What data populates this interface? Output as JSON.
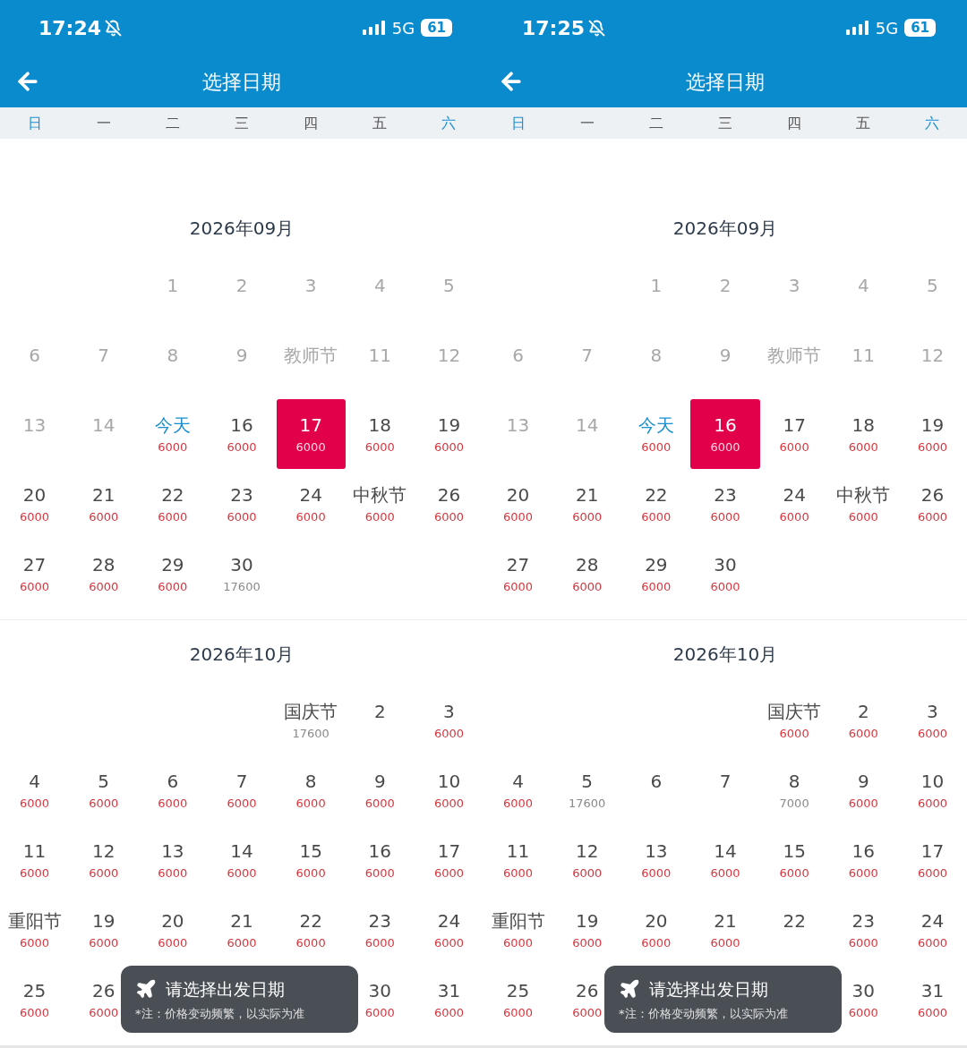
{
  "screens": [
    {
      "status_bar": {
        "time": "17:24",
        "network": "5G",
        "battery": "61"
      },
      "nav": {
        "title": "选择日期"
      },
      "weekdays": [
        {
          "label": "日",
          "weekend": true
        },
        {
          "label": "一",
          "weekend": false
        },
        {
          "label": "二",
          "weekend": false
        },
        {
          "label": "三",
          "weekend": false
        },
        {
          "label": "四",
          "weekend": false
        },
        {
          "label": "五",
          "weekend": false
        },
        {
          "label": "六",
          "weekend": true
        }
      ],
      "months": [
        {
          "title": "2026年09月",
          "days": [
            {
              "kind": "blank"
            },
            {
              "kind": "blank"
            },
            {
              "kind": "past",
              "label": "1"
            },
            {
              "kind": "past",
              "label": "2"
            },
            {
              "kind": "past",
              "label": "3"
            },
            {
              "kind": "past",
              "label": "4"
            },
            {
              "kind": "past",
              "label": "5"
            },
            {
              "kind": "past",
              "label": "6"
            },
            {
              "kind": "past",
              "label": "7"
            },
            {
              "kind": "past",
              "label": "8"
            },
            {
              "kind": "past",
              "label": "9"
            },
            {
              "kind": "past",
              "label": "教师节"
            },
            {
              "kind": "past",
              "label": "11"
            },
            {
              "kind": "past",
              "label": "12"
            },
            {
              "kind": "past",
              "label": "13"
            },
            {
              "kind": "past",
              "label": "14"
            },
            {
              "kind": "today",
              "label": "今天",
              "price": "6000",
              "price_muted": false,
              "selected": false
            },
            {
              "kind": "open",
              "label": "16",
              "price": "6000",
              "price_muted": false,
              "selected": false
            },
            {
              "kind": "open",
              "label": "17",
              "price": "6000",
              "price_muted": false,
              "selected": true
            },
            {
              "kind": "open",
              "label": "18",
              "price": "6000",
              "price_muted": false,
              "selected": false
            },
            {
              "kind": "open",
              "label": "19",
              "price": "6000",
              "price_muted": false,
              "selected": false
            },
            {
              "kind": "open",
              "label": "20",
              "price": "6000",
              "price_muted": false,
              "selected": false
            },
            {
              "kind": "open",
              "label": "21",
              "price": "6000",
              "price_muted": false,
              "selected": false
            },
            {
              "kind": "open",
              "label": "22",
              "price": "6000",
              "price_muted": false,
              "selected": false
            },
            {
              "kind": "open",
              "label": "23",
              "price": "6000",
              "price_muted": false,
              "selected": false
            },
            {
              "kind": "open",
              "label": "24",
              "price": "6000",
              "price_muted": false,
              "selected": false
            },
            {
              "kind": "open",
              "label": "中秋节",
              "price": "6000",
              "price_muted": false,
              "selected": false
            },
            {
              "kind": "open",
              "label": "26",
              "price": "6000",
              "price_muted": false,
              "selected": false
            },
            {
              "kind": "open",
              "label": "27",
              "price": "6000",
              "price_muted": false,
              "selected": false
            },
            {
              "kind": "open",
              "label": "28",
              "price": "6000",
              "price_muted": false,
              "selected": false
            },
            {
              "kind": "open",
              "label": "29",
              "price": "6000",
              "price_muted": false,
              "selected": false
            },
            {
              "kind": "open",
              "label": "30",
              "price": "17600",
              "price_muted": true,
              "selected": false
            }
          ]
        },
        {
          "title": "2026年10月",
          "days": [
            {
              "kind": "blank"
            },
            {
              "kind": "blank"
            },
            {
              "kind": "blank"
            },
            {
              "kind": "blank"
            },
            {
              "kind": "open",
              "label": "国庆节",
              "price": "17600",
              "price_muted": true,
              "selected": false
            },
            {
              "kind": "open",
              "label": "2",
              "selected": false
            },
            {
              "kind": "open",
              "label": "3",
              "price": "6000",
              "price_muted": false,
              "selected": false
            },
            {
              "kind": "open",
              "label": "4",
              "price": "6000",
              "price_muted": false,
              "selected": false
            },
            {
              "kind": "open",
              "label": "5",
              "price": "6000",
              "price_muted": false,
              "selected": false
            },
            {
              "kind": "open",
              "label": "6",
              "price": "6000",
              "price_muted": false,
              "selected": false
            },
            {
              "kind": "open",
              "label": "7",
              "price": "6000",
              "price_muted": false,
              "selected": false
            },
            {
              "kind": "open",
              "label": "8",
              "price": "6000",
              "price_muted": false,
              "selected": false
            },
            {
              "kind": "open",
              "label": "9",
              "price": "6000",
              "price_muted": false,
              "selected": false
            },
            {
              "kind": "open",
              "label": "10",
              "price": "6000",
              "price_muted": false,
              "selected": false
            },
            {
              "kind": "open",
              "label": "11",
              "price": "6000",
              "price_muted": false,
              "selected": false
            },
            {
              "kind": "open",
              "label": "12",
              "price": "6000",
              "price_muted": false,
              "selected": false
            },
            {
              "kind": "open",
              "label": "13",
              "price": "6000",
              "price_muted": false,
              "selected": false
            },
            {
              "kind": "open",
              "label": "14",
              "price": "6000",
              "price_muted": false,
              "selected": false
            },
            {
              "kind": "open",
              "label": "15",
              "price": "6000",
              "price_muted": false,
              "selected": false
            },
            {
              "kind": "open",
              "label": "16",
              "price": "6000",
              "price_muted": false,
              "selected": false
            },
            {
              "kind": "open",
              "label": "17",
              "price": "6000",
              "price_muted": false,
              "selected": false
            },
            {
              "kind": "open",
              "label": "重阳节",
              "price": "6000",
              "price_muted": false,
              "selected": false
            },
            {
              "kind": "open",
              "label": "19",
              "price": "6000",
              "price_muted": false,
              "selected": false
            },
            {
              "kind": "open",
              "label": "20",
              "price": "6000",
              "price_muted": false,
              "selected": false
            },
            {
              "kind": "open",
              "label": "21",
              "price": "6000",
              "price_muted": false,
              "selected": false
            },
            {
              "kind": "open",
              "label": "22",
              "price": "6000",
              "price_muted": false,
              "selected": false
            },
            {
              "kind": "open",
              "label": "23",
              "price": "6000",
              "price_muted": false,
              "selected": false
            },
            {
              "kind": "open",
              "label": "24",
              "price": "6000",
              "price_muted": false,
              "selected": false
            },
            {
              "kind": "open",
              "label": "25",
              "price": "6000",
              "price_muted": false,
              "selected": false
            },
            {
              "kind": "open",
              "label": "26",
              "price": "6000",
              "price_muted": false,
              "selected": false
            },
            {
              "kind": "hidden"
            },
            {
              "kind": "hidden"
            },
            {
              "kind": "hidden"
            },
            {
              "kind": "open",
              "label": "30",
              "price": "6000",
              "price_muted": false,
              "selected": false
            },
            {
              "kind": "open",
              "label": "31",
              "price": "6000",
              "price_muted": false,
              "selected": false
            }
          ]
        }
      ],
      "toast": {
        "title": "请选择出发日期",
        "note": "*注：价格变动频繁，以实际为准"
      }
    },
    {
      "status_bar": {
        "time": "17:25",
        "network": "5G",
        "battery": "61"
      },
      "nav": {
        "title": "选择日期"
      },
      "weekdays": [
        {
          "label": "日",
          "weekend": true
        },
        {
          "label": "一",
          "weekend": false
        },
        {
          "label": "二",
          "weekend": false
        },
        {
          "label": "三",
          "weekend": false
        },
        {
          "label": "四",
          "weekend": false
        },
        {
          "label": "五",
          "weekend": false
        },
        {
          "label": "六",
          "weekend": true
        }
      ],
      "months": [
        {
          "title": "2026年09月",
          "days": [
            {
              "kind": "blank"
            },
            {
              "kind": "blank"
            },
            {
              "kind": "past",
              "label": "1"
            },
            {
              "kind": "past",
              "label": "2"
            },
            {
              "kind": "past",
              "label": "3"
            },
            {
              "kind": "past",
              "label": "4"
            },
            {
              "kind": "past",
              "label": "5"
            },
            {
              "kind": "past",
              "label": "6"
            },
            {
              "kind": "past",
              "label": "7"
            },
            {
              "kind": "past",
              "label": "8"
            },
            {
              "kind": "past",
              "label": "9"
            },
            {
              "kind": "past",
              "label": "教师节"
            },
            {
              "kind": "past",
              "label": "11"
            },
            {
              "kind": "past",
              "label": "12"
            },
            {
              "kind": "past",
              "label": "13"
            },
            {
              "kind": "past",
              "label": "14"
            },
            {
              "kind": "today",
              "label": "今天",
              "price": "6000",
              "price_muted": false,
              "selected": false
            },
            {
              "kind": "open",
              "label": "16",
              "price": "6000",
              "price_muted": false,
              "selected": true
            },
            {
              "kind": "open",
              "label": "17",
              "price": "6000",
              "price_muted": false,
              "selected": false
            },
            {
              "kind": "open",
              "label": "18",
              "price": "6000",
              "price_muted": false,
              "selected": false
            },
            {
              "kind": "open",
              "label": "19",
              "price": "6000",
              "price_muted": false,
              "selected": false
            },
            {
              "kind": "open",
              "label": "20",
              "price": "6000",
              "price_muted": false,
              "selected": false
            },
            {
              "kind": "open",
              "label": "21",
              "price": "6000",
              "price_muted": false,
              "selected": false
            },
            {
              "kind": "open",
              "label": "22",
              "price": "6000",
              "price_muted": false,
              "selected": false
            },
            {
              "kind": "open",
              "label": "23",
              "price": "6000",
              "price_muted": false,
              "selected": false
            },
            {
              "kind": "open",
              "label": "24",
              "price": "6000",
              "price_muted": false,
              "selected": false
            },
            {
              "kind": "open",
              "label": "中秋节",
              "price": "6000",
              "price_muted": false,
              "selected": false
            },
            {
              "kind": "open",
              "label": "26",
              "price": "6000",
              "price_muted": false,
              "selected": false
            },
            {
              "kind": "open",
              "label": "27",
              "price": "6000",
              "price_muted": false,
              "selected": false
            },
            {
              "kind": "open",
              "label": "28",
              "price": "6000",
              "price_muted": false,
              "selected": false
            },
            {
              "kind": "open",
              "label": "29",
              "price": "6000",
              "price_muted": false,
              "selected": false
            },
            {
              "kind": "open",
              "label": "30",
              "price": "6000",
              "price_muted": false,
              "selected": false
            }
          ]
        },
        {
          "title": "2026年10月",
          "days": [
            {
              "kind": "blank"
            },
            {
              "kind": "blank"
            },
            {
              "kind": "blank"
            },
            {
              "kind": "blank"
            },
            {
              "kind": "open",
              "label": "国庆节",
              "price": "6000",
              "price_muted": false,
              "selected": false
            },
            {
              "kind": "open",
              "label": "2",
              "price": "6000",
              "price_muted": false,
              "selected": false
            },
            {
              "kind": "open",
              "label": "3",
              "price": "6000",
              "price_muted": false,
              "selected": false
            },
            {
              "kind": "open",
              "label": "4",
              "price": "6000",
              "price_muted": false,
              "selected": false
            },
            {
              "kind": "open",
              "label": "5",
              "price": "17600",
              "price_muted": true,
              "selected": false
            },
            {
              "kind": "open",
              "label": "6",
              "selected": false
            },
            {
              "kind": "open",
              "label": "7",
              "selected": false
            },
            {
              "kind": "open",
              "label": "8",
              "price": "7000",
              "price_muted": true,
              "selected": false
            },
            {
              "kind": "open",
              "label": "9",
              "price": "6000",
              "price_muted": false,
              "selected": false
            },
            {
              "kind": "open",
              "label": "10",
              "price": "6000",
              "price_muted": false,
              "selected": false
            },
            {
              "kind": "open",
              "label": "11",
              "price": "6000",
              "price_muted": false,
              "selected": false
            },
            {
              "kind": "open",
              "label": "12",
              "price": "6000",
              "price_muted": false,
              "selected": false
            },
            {
              "kind": "open",
              "label": "13",
              "price": "6000",
              "price_muted": false,
              "selected": false
            },
            {
              "kind": "open",
              "label": "14",
              "price": "6000",
              "price_muted": false,
              "selected": false
            },
            {
              "kind": "open",
              "label": "15",
              "price": "6000",
              "price_muted": false,
              "selected": false
            },
            {
              "kind": "open",
              "label": "16",
              "price": "6000",
              "price_muted": false,
              "selected": false
            },
            {
              "kind": "open",
              "label": "17",
              "price": "6000",
              "price_muted": false,
              "selected": false
            },
            {
              "kind": "open",
              "label": "重阳节",
              "price": "6000",
              "price_muted": false,
              "selected": false
            },
            {
              "kind": "open",
              "label": "19",
              "price": "6000",
              "price_muted": false,
              "selected": false
            },
            {
              "kind": "open",
              "label": "20",
              "price": "6000",
              "price_muted": false,
              "selected": false
            },
            {
              "kind": "open",
              "label": "21",
              "price": "6000",
              "price_muted": false,
              "selected": false
            },
            {
              "kind": "open",
              "label": "22",
              "selected": false
            },
            {
              "kind": "open",
              "label": "23",
              "price": "6000",
              "price_muted": false,
              "selected": false
            },
            {
              "kind": "open",
              "label": "24",
              "price": "6000",
              "price_muted": false,
              "selected": false
            },
            {
              "kind": "open",
              "label": "25",
              "price": "6000",
              "price_muted": false,
              "selected": false
            },
            {
              "kind": "open",
              "label": "26",
              "price": "6000",
              "price_muted": false,
              "selected": false
            },
            {
              "kind": "hidden"
            },
            {
              "kind": "hidden"
            },
            {
              "kind": "hidden"
            },
            {
              "kind": "open",
              "label": "30",
              "price": "6000",
              "price_muted": false,
              "selected": false
            },
            {
              "kind": "open",
              "label": "31",
              "price": "6000",
              "price_muted": false,
              "selected": false
            }
          ]
        }
      ],
      "toast": {
        "title": "请选择出发日期",
        "note": "*注：价格变动频繁，以实际为准"
      }
    }
  ]
}
